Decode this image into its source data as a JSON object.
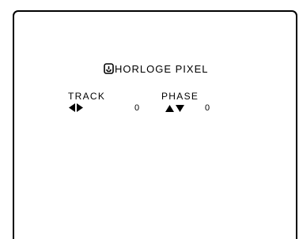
{
  "menu": {
    "title": "HORLOGE PIXEL",
    "title_icon": "clock-icon"
  },
  "controls": {
    "track": {
      "label": "TRACK",
      "adjust_icon": "left-right-arrows-icon",
      "value": "0"
    },
    "phase": {
      "label": "PHASE",
      "adjust_icon": "up-down-arrows-icon",
      "value": "0"
    }
  },
  "colors": {
    "background": "#ffffff",
    "foreground": "#000000"
  }
}
